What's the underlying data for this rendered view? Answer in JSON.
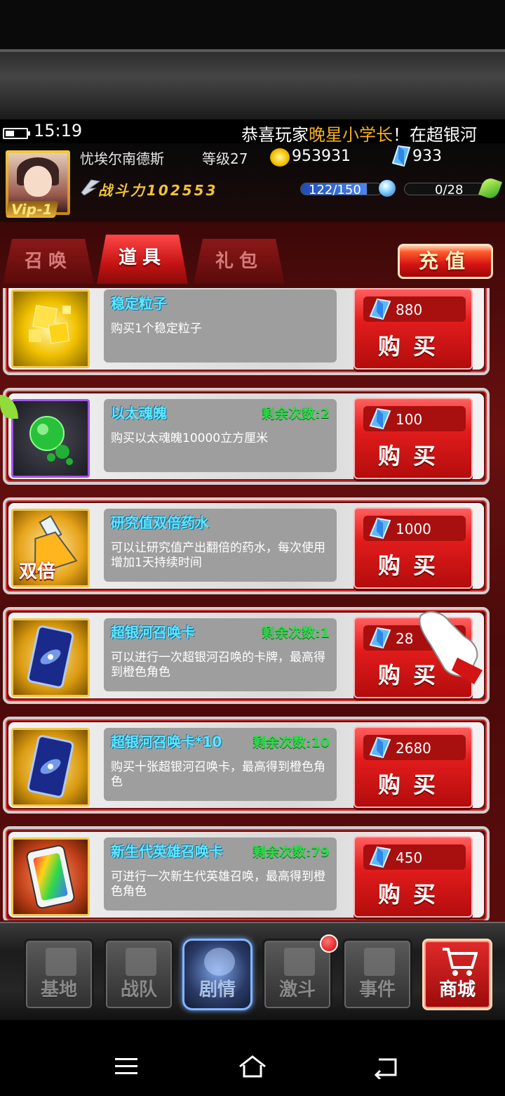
{
  "status": {
    "time": "15:19"
  },
  "marquee": {
    "prefix": "恭喜玩家",
    "player": "晚星小学长",
    "suffix": "！在超银河"
  },
  "player": {
    "name": "忧埃尔南德斯",
    "level": "等级27",
    "coins": "953931",
    "gems": "933",
    "vip": "Vip-1",
    "power": "战斗力102553",
    "energy": "122/150",
    "energy_fraction": 0.813,
    "xp": "0/28",
    "xp_fraction": 0
  },
  "tabs": [
    {
      "label": "召唤",
      "active": false
    },
    {
      "label": "道具",
      "active": true
    },
    {
      "label": "礼包",
      "active": false
    }
  ],
  "recharge_label": "充值",
  "buy_label": "购买",
  "items": [
    {
      "name": "稳定粒子",
      "remain": "",
      "desc": "购买1个稳定粒子",
      "price": "880",
      "icon": "particle-icon"
    },
    {
      "name": "以太魂魄",
      "remain": "剩余次数:2",
      "desc": "购买以太魂魄10000立方厘米",
      "price": "100",
      "icon": "ether-soul-icon"
    },
    {
      "name": "研究值双倍药水",
      "remain": "",
      "desc": "可以让研究值产出翻倍的药水，每次使用增加1天持续时间",
      "price": "1000",
      "icon": "double-potion-icon",
      "badge": "双倍"
    },
    {
      "name": "超银河召唤卡",
      "remain": "剩余次数:1",
      "desc": "可以进行一次超银河召唤的卡牌，最高得到橙色角色",
      "price": "28",
      "icon": "galaxy-card-icon"
    },
    {
      "name": "超银河召唤卡*10",
      "remain": "剩余次数:10",
      "desc": "购买十张超银河召唤卡，最高得到橙色角色",
      "price": "2680",
      "icon": "galaxy-card-icon"
    },
    {
      "name": "新生代英雄召唤卡",
      "remain": "剩余次数:79",
      "desc": "可进行一次新生代英雄召唤，最高得到橙色角色",
      "price": "450",
      "icon": "new-hero-card-icon"
    }
  ],
  "nav": [
    {
      "label": "基地"
    },
    {
      "label": "战队"
    },
    {
      "label": "剧情"
    },
    {
      "label": "激斗"
    },
    {
      "label": "事件"
    },
    {
      "label": "商城"
    }
  ],
  "colors": {
    "item_name": "#5fe8ff",
    "remain": "#2fd94a",
    "highlight": "#f7b21b",
    "button_red": "#e21c1c"
  }
}
